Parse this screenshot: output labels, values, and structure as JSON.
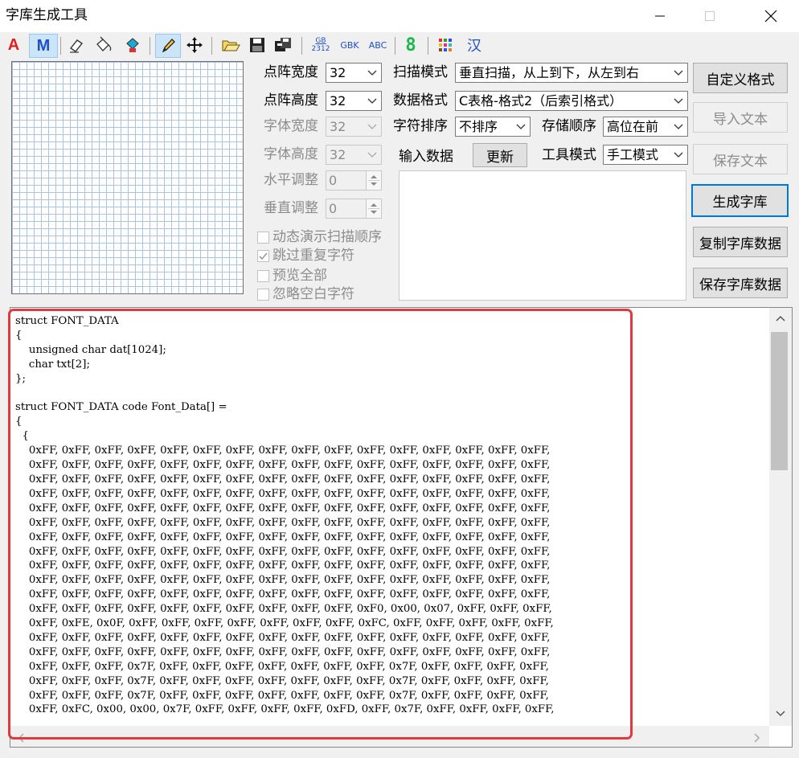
{
  "window": {
    "title": "字库生成工具"
  },
  "toolbar": {
    "a_label": "A",
    "m_label": "M",
    "gb_top": "GB",
    "gb_bottom": "2312",
    "gbk": "GBK",
    "abc": "ABC",
    "eight": "8",
    "han": "汉"
  },
  "params": {
    "dot_width": {
      "label": "点阵宽度",
      "value": "32"
    },
    "dot_height": {
      "label": "点阵高度",
      "value": "32"
    },
    "font_width": {
      "label": "字体宽度",
      "value": "32"
    },
    "font_height": {
      "label": "字体高度",
      "value": "32"
    },
    "h_adjust": {
      "label": "水平调整",
      "value": "0"
    },
    "v_adjust": {
      "label": "垂直调整",
      "value": "0"
    }
  },
  "options": {
    "animate": "动态演示扫描顺序",
    "skip_dup": "跳过重复字符",
    "preview_all": "预览全部",
    "ignore_blank": "忽略空白字符"
  },
  "settings": {
    "scan_mode": {
      "label": "扫描模式",
      "value": "垂直扫描，从上到下，从左到右"
    },
    "data_format": {
      "label": "数据格式",
      "value": "C表格-格式2（后索引格式）"
    },
    "char_sort": {
      "label": "字符排序",
      "value": "不排序"
    },
    "store_order": {
      "label": "存储顺序",
      "value": "高位在前"
    },
    "input_label": "输入数据",
    "update_btn": "更新",
    "tool_mode": {
      "label": "工具模式",
      "value": "手工模式"
    }
  },
  "buttons": {
    "custom_format": "自定义格式",
    "import_text": "导入文本",
    "save_text": "保存文本",
    "generate": "生成字库",
    "copy_data": "复制字库数据",
    "save_data": "保存字库数据"
  },
  "code_lines": [
    "struct FONT_DATA",
    "{",
    "    unsigned char dat[1024];",
    "    char txt[2];",
    "};",
    "",
    "struct FONT_DATA code Font_Data[] =",
    "{",
    "  {",
    "    0xFF, 0xFF, 0xFF, 0xFF, 0xFF, 0xFF, 0xFF, 0xFF, 0xFF, 0xFF, 0xFF, 0xFF, 0xFF, 0xFF, 0xFF, 0xFF,",
    "    0xFF, 0xFF, 0xFF, 0xFF, 0xFF, 0xFF, 0xFF, 0xFF, 0xFF, 0xFF, 0xFF, 0xFF, 0xFF, 0xFF, 0xFF, 0xFF,",
    "    0xFF, 0xFF, 0xFF, 0xFF, 0xFF, 0xFF, 0xFF, 0xFF, 0xFF, 0xFF, 0xFF, 0xFF, 0xFF, 0xFF, 0xFF, 0xFF,",
    "    0xFF, 0xFF, 0xFF, 0xFF, 0xFF, 0xFF, 0xFF, 0xFF, 0xFF, 0xFF, 0xFF, 0xFF, 0xFF, 0xFF, 0xFF, 0xFF,",
    "    0xFF, 0xFF, 0xFF, 0xFF, 0xFF, 0xFF, 0xFF, 0xFF, 0xFF, 0xFF, 0xFF, 0xFF, 0xFF, 0xFF, 0xFF, 0xFF,",
    "    0xFF, 0xFF, 0xFF, 0xFF, 0xFF, 0xFF, 0xFF, 0xFF, 0xFF, 0xFF, 0xFF, 0xFF, 0xFF, 0xFF, 0xFF, 0xFF,",
    "    0xFF, 0xFF, 0xFF, 0xFF, 0xFF, 0xFF, 0xFF, 0xFF, 0xFF, 0xFF, 0xFF, 0xFF, 0xFF, 0xFF, 0xFF, 0xFF,",
    "    0xFF, 0xFF, 0xFF, 0xFF, 0xFF, 0xFF, 0xFF, 0xFF, 0xFF, 0xFF, 0xFF, 0xFF, 0xFF, 0xFF, 0xFF, 0xFF,",
    "    0xFF, 0xFF, 0xFF, 0xFF, 0xFF, 0xFF, 0xFF, 0xFF, 0xFF, 0xFF, 0xFF, 0xFF, 0xFF, 0xFF, 0xFF, 0xFF,",
    "    0xFF, 0xFF, 0xFF, 0xFF, 0xFF, 0xFF, 0xFF, 0xFF, 0xFF, 0xFF, 0xFF, 0xFF, 0xFF, 0xFF, 0xFF, 0xFF,",
    "    0xFF, 0xFF, 0xFF, 0xFF, 0xFF, 0xFF, 0xFF, 0xFF, 0xFF, 0xFF, 0xFF, 0xFF, 0xFF, 0xFF, 0xFF, 0xFF,",
    "    0xFF, 0xFF, 0xFF, 0xFF, 0xFF, 0xFF, 0xFF, 0xFF, 0xFF, 0xFF, 0xF0, 0x00, 0x07, 0xFF, 0xFF, 0xFF,",
    "    0xFF, 0xFE, 0x0F, 0xFF, 0xFF, 0xFF, 0xFF, 0xFF, 0xFF, 0xFF, 0xFC, 0xFF, 0xFF, 0xFF, 0xFF, 0xFF,",
    "    0xFF, 0xFF, 0xFF, 0xFF, 0xFF, 0xFF, 0xFF, 0xFF, 0xFF, 0xFF, 0xFF, 0xFF, 0xFF, 0xFF, 0xFF, 0xFF,",
    "    0xFF, 0xFF, 0xFF, 0xFF, 0xFF, 0xFF, 0xFF, 0xFF, 0xFF, 0xFF, 0xFF, 0xFF, 0xFF, 0xFF, 0xFF, 0xFF,",
    "    0xFF, 0xFF, 0xFF, 0x7F, 0xFF, 0xFF, 0xFF, 0xFF, 0xFF, 0xFF, 0xFF, 0x7F, 0xFF, 0xFF, 0xFF, 0xFF,",
    "    0xFF, 0xFF, 0xFF, 0x7F, 0xFF, 0xFF, 0xFF, 0xFF, 0xFF, 0xFF, 0xFF, 0x7F, 0xFF, 0xFF, 0xFF, 0xFF,",
    "    0xFF, 0xFF, 0xFF, 0x7F, 0xFF, 0xFF, 0xFF, 0xFF, 0xFF, 0xFF, 0xFF, 0x7F, 0xFF, 0xFF, 0xFF, 0xFF,",
    "    0xFF, 0xFC, 0x00, 0x00, 0x7F, 0xFF, 0xFF, 0xFF, 0xFF, 0xFD, 0xFF, 0x7F, 0xFF, 0xFF, 0xFF, 0xFF,"
  ],
  "colors": {
    "highlight": "#e0393e",
    "focus": "#0078d7",
    "grid_line": "#a8c4e0"
  }
}
